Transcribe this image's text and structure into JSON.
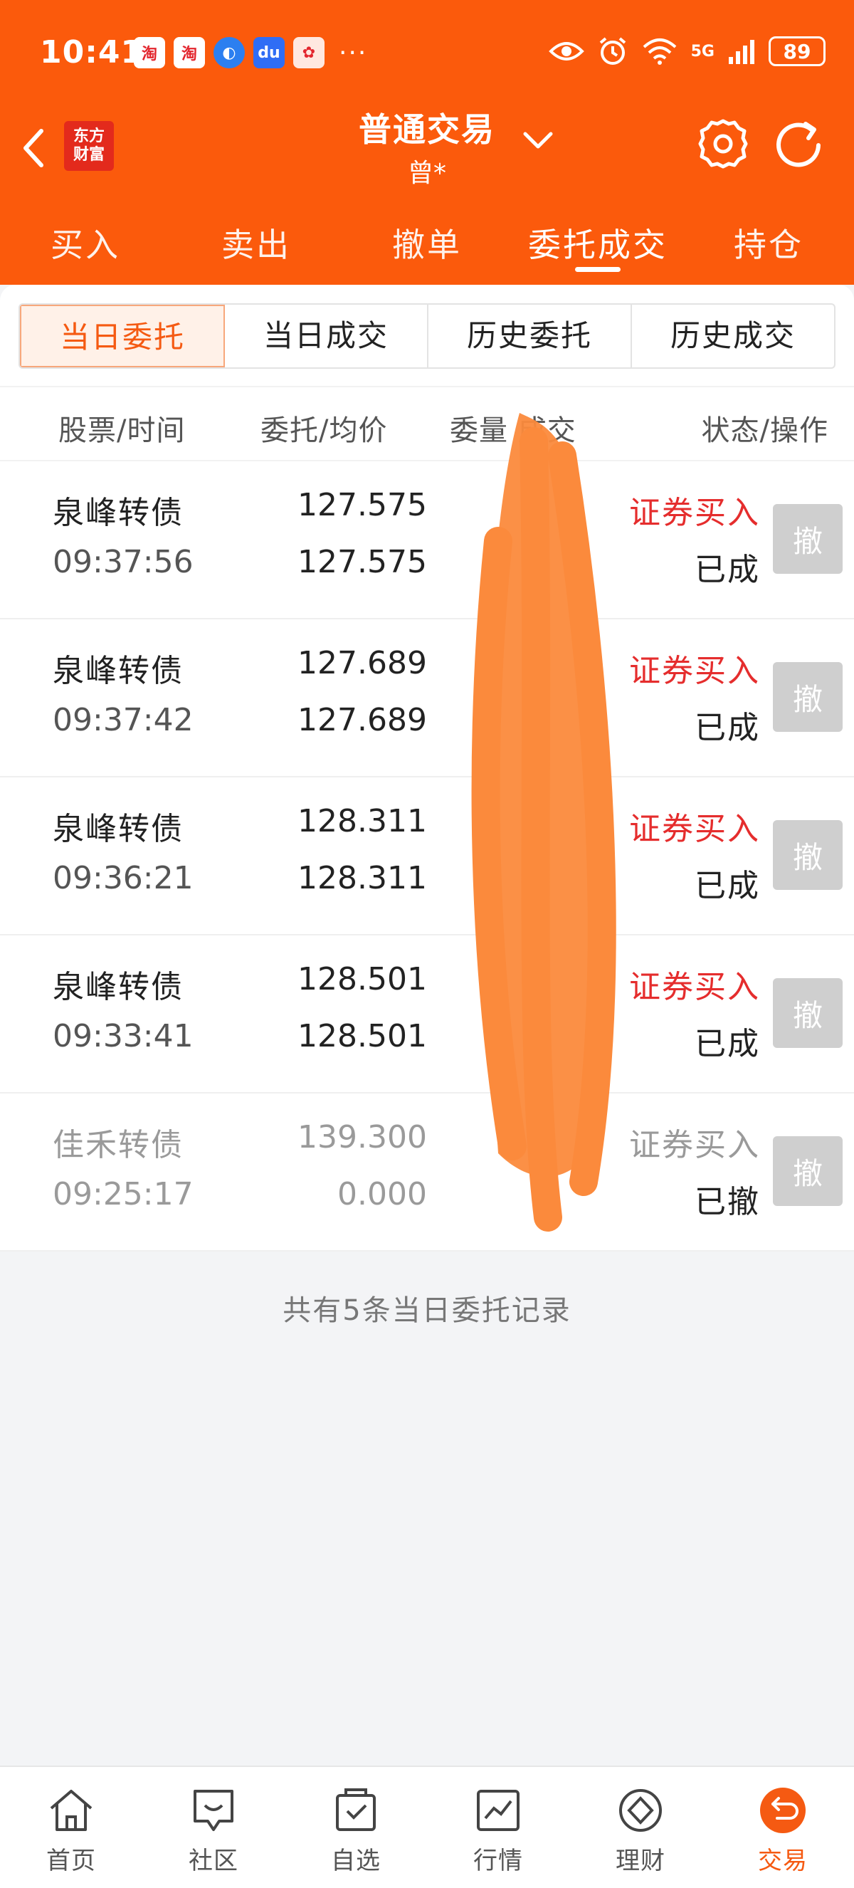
{
  "status_bar": {
    "time": "10:41",
    "notifications": [
      "taobao-icon",
      "taobao-icon",
      "browser-icon",
      "baidu-icon",
      "promo-icon"
    ],
    "more": "···",
    "network": "5G",
    "battery": "89"
  },
  "nav": {
    "logo_line1": "东方",
    "logo_line2": "财富",
    "title": "普通交易",
    "subtitle": "曾*"
  },
  "main_tabs": [
    {
      "label": "买入",
      "active": false
    },
    {
      "label": "卖出",
      "active": false
    },
    {
      "label": "撤单",
      "active": false
    },
    {
      "label": "委托成交",
      "active": true
    },
    {
      "label": "持仓",
      "active": false
    }
  ],
  "segments": [
    {
      "label": "当日委托",
      "active": true
    },
    {
      "label": "当日成交",
      "active": false
    },
    {
      "label": "历史委托",
      "active": false
    },
    {
      "label": "历史成交",
      "active": false
    }
  ],
  "columns": {
    "stock_time": "股票/时间",
    "order_avg": "委托/均价",
    "qty_filled": "委量 成交",
    "status_action": "状态/操作"
  },
  "orders": [
    {
      "name": "泉峰转债",
      "time": "09:37:56",
      "order_price": "127.575",
      "avg_price": "127.575",
      "direction": "证券买入",
      "status": "已成",
      "cancel": "撤",
      "dim": false
    },
    {
      "name": "泉峰转债",
      "time": "09:37:42",
      "order_price": "127.689",
      "avg_price": "127.689",
      "direction": "证券买入",
      "status": "已成",
      "cancel": "撤",
      "dim": false
    },
    {
      "name": "泉峰转债",
      "time": "09:36:21",
      "order_price": "128.311",
      "avg_price": "128.311",
      "direction": "证券买入",
      "status": "已成",
      "cancel": "撤",
      "dim": false
    },
    {
      "name": "泉峰转债",
      "time": "09:33:41",
      "order_price": "128.501",
      "avg_price": "128.501",
      "direction": "证券买入",
      "status": "已成",
      "cancel": "撤",
      "dim": false
    },
    {
      "name": "佳禾转债",
      "time": "09:25:17",
      "order_price": "139.300",
      "avg_price": "0.000",
      "direction": "证券买入",
      "status": "已撤",
      "cancel": "撤",
      "dim": true
    }
  ],
  "footer_note": "共有5条当日委托记录",
  "bottom_nav": [
    {
      "label": "首页",
      "icon": "home-icon",
      "active": false
    },
    {
      "label": "社区",
      "icon": "community-icon",
      "active": false
    },
    {
      "label": "自选",
      "icon": "watchlist-icon",
      "active": false
    },
    {
      "label": "行情",
      "icon": "market-icon",
      "active": false
    },
    {
      "label": "理财",
      "icon": "wealth-icon",
      "active": false
    },
    {
      "label": "交易",
      "icon": "trade-icon",
      "active": true
    }
  ],
  "colors": {
    "brand": "#fb5a0c",
    "buy_red": "#e52d2d",
    "active_text": "#f55a12"
  }
}
